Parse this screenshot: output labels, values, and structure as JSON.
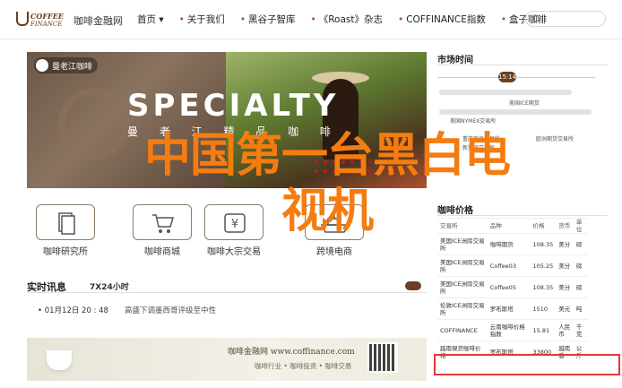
{
  "header": {
    "logo_top": "COFFEE",
    "logo_bottom": "FINANCE",
    "site_name": "咖啡金融网",
    "nav": [
      {
        "label": "首页 ▾",
        "dot": ""
      },
      {
        "label": "关于我们",
        "dot": "•"
      },
      {
        "label": "黑谷子智库",
        "dot": "•"
      },
      {
        "label": "《Roast》杂志",
        "dot": "•"
      },
      {
        "label": "COFFINANCE指数",
        "dot": "•"
      },
      {
        "label": "盒子咖啡",
        "dot": "•"
      }
    ]
  },
  "banner": {
    "brand": "曼老江咖啡",
    "headline": "SPECIALTY",
    "subline": "曼 老 江 精 品 咖 啡"
  },
  "overlay": {
    "line1": "中国第一台黑白电",
    "line2": "视机"
  },
  "tiles": [
    {
      "label": "咖啡研究所",
      "icon": "book-icon"
    },
    {
      "label": "咖啡商城",
      "icon": "cart-icon"
    },
    {
      "label": "咖啡大宗交易",
      "icon": "yen-icon"
    },
    {
      "label": "跨境电商",
      "icon": "ship-icon"
    }
  ],
  "news": {
    "title": "实时讯息",
    "tag": "7X24小时",
    "items": [
      {
        "time": "• 01月12日 20 : 48",
        "text": "高盛下调墨西哥评级至中性"
      }
    ]
  },
  "ad": {
    "main": "咖啡金融网  www.coffinance.com",
    "sub": "咖啡行业 • 咖啡投资 • 咖啡交易"
  },
  "market_time": {
    "title": "市场时间",
    "now": "15:14",
    "labels": [
      "美国ICE期货",
      "美国NYMEX交易所",
      "重庆商品交易所",
      "欧洲期货交易所",
      "新加坡交易所"
    ]
  },
  "price": {
    "title": "咖啡价格",
    "headers": [
      "交易所",
      "品种",
      "价格",
      "货币",
      "单位"
    ],
    "rows": [
      [
        "美国ICE洲际交易所",
        "咖啡期货",
        "108.35",
        "美分",
        "磅"
      ],
      [
        "美国ICE洲际交易所",
        "Coffee03",
        "105.25",
        "美分",
        "磅"
      ],
      [
        "美国ICE洲际交易所",
        "Coffee05",
        "108.35",
        "美分",
        "磅"
      ],
      [
        "伦敦ICE洲际交易所",
        "罗布斯塔",
        "1510",
        "美元",
        "吨"
      ],
      [
        "COFFINANCE",
        "云南咖啡价格指数",
        "15.81",
        "人民币",
        "千克"
      ],
      [
        "越南現货咖啡价格",
        "罗布斯塔",
        "33800",
        "越南盾",
        "公斤"
      ]
    ]
  }
}
